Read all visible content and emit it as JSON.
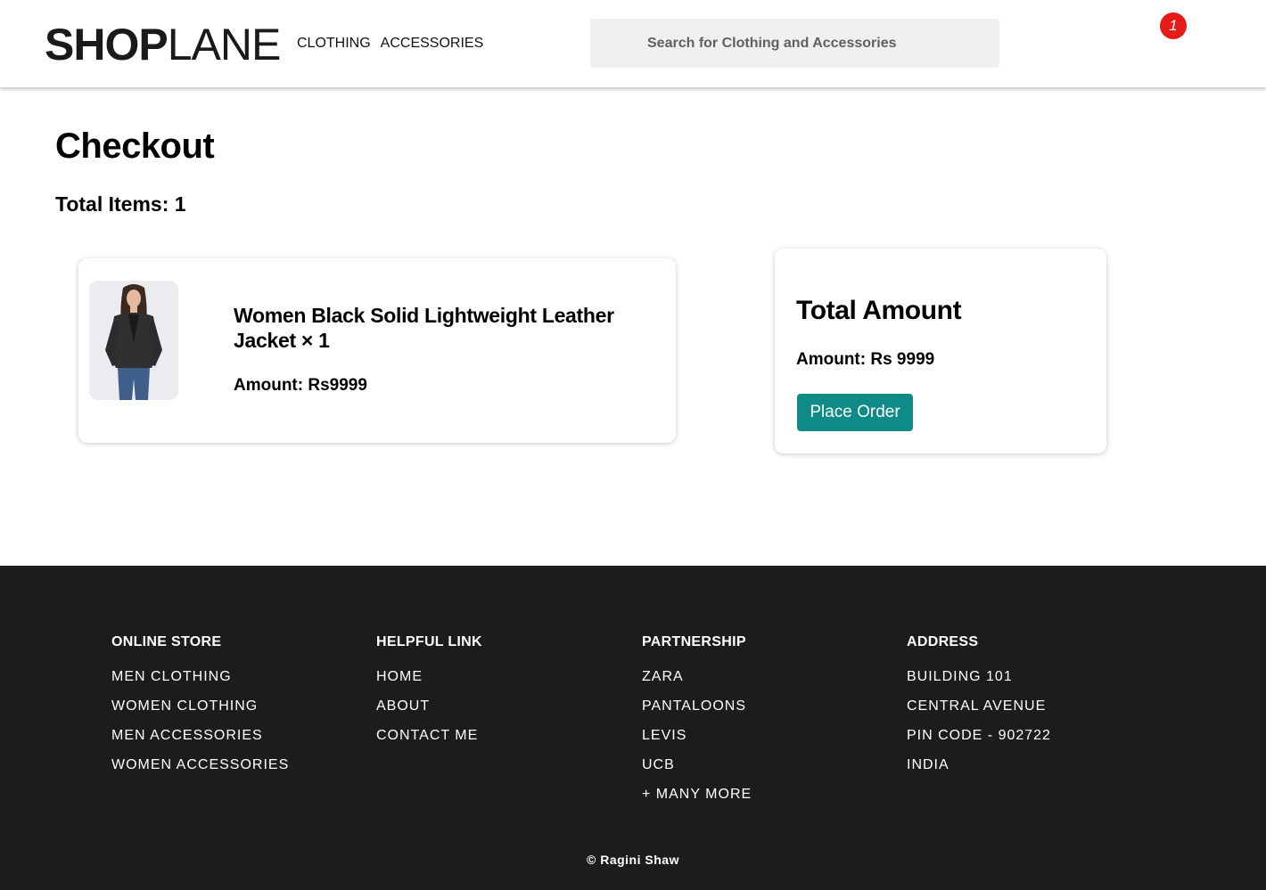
{
  "header": {
    "logo_bold": "SHOP",
    "logo_light": "LANE",
    "nav": [
      "CLOTHING",
      "ACCESSORIES"
    ],
    "search_placeholder": "Search for Clothing and Accessories",
    "cart_icon": "cart-icon",
    "cart_count": "1"
  },
  "checkout": {
    "title": "Checkout",
    "total_items": "Total Items: 1",
    "items": [
      {
        "name": "Women Black Solid Lightweight Leather Jacket × 1",
        "amount": "Amount: Rs9999"
      }
    ],
    "summary": {
      "title": "Total Amount",
      "amount": "Amount: Rs 9999",
      "button": "Place Order"
    }
  },
  "footer": {
    "columns": [
      {
        "heading": "ONLINE STORE",
        "links": [
          "MEN CLOTHING",
          "WOMEN CLOTHING",
          "MEN ACCESSORIES",
          "WOMEN ACCESSORIES"
        ]
      },
      {
        "heading": "HELPFUL LINK",
        "links": [
          "HOME",
          "ABOUT",
          "CONTACT ME"
        ]
      },
      {
        "heading": "PARTNERSHIP",
        "links": [
          "ZARA",
          "PANTALOONS",
          "LEVIS",
          "UCB",
          "+ MANY MORE"
        ]
      },
      {
        "heading": "ADDRESS",
        "lines": [
          "BUILDING 101",
          "CENTRAL AVENUE",
          "PIN CODE - 902722",
          "INDIA"
        ]
      }
    ],
    "copyright": "© Ragini Shaw"
  },
  "colors": {
    "accent": "#0e8a87",
    "badge": "#e41b17",
    "footer_bg": "#1c1c1c",
    "search_bg": "#f0f0f0"
  }
}
